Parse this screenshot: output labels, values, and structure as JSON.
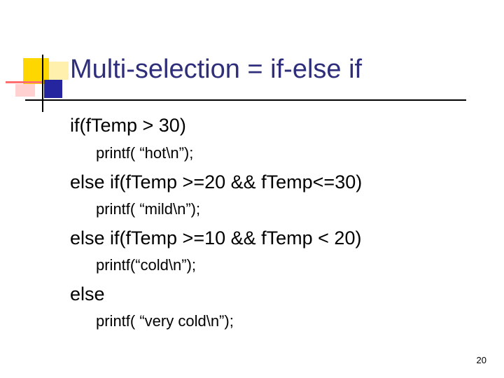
{
  "slide": {
    "title": "Multi-selection = if-else if",
    "lines": [
      {
        "level": 1,
        "text": "if(fTemp > 30)"
      },
      {
        "level": 2,
        "text": "printf( “hot\\n”);"
      },
      {
        "level": 1,
        "text": "else if(fTemp >=20 && fTemp<=30)"
      },
      {
        "level": 2,
        "text": "printf( “mild\\n”);"
      },
      {
        "level": 1,
        "text": "else if(fTemp >=10 && fTemp < 20)"
      },
      {
        "level": 2,
        "text": "printf(“cold\\n”);"
      },
      {
        "level": 1,
        "text": "else"
      },
      {
        "level": 2,
        "text": "printf( “very cold\\n”);"
      }
    ],
    "page_number": "20"
  },
  "colors": {
    "title": "#2e2e7a",
    "logo_yellow": "#ffd700",
    "logo_red": "#ff6f6f",
    "logo_blue": "#2525a0"
  }
}
